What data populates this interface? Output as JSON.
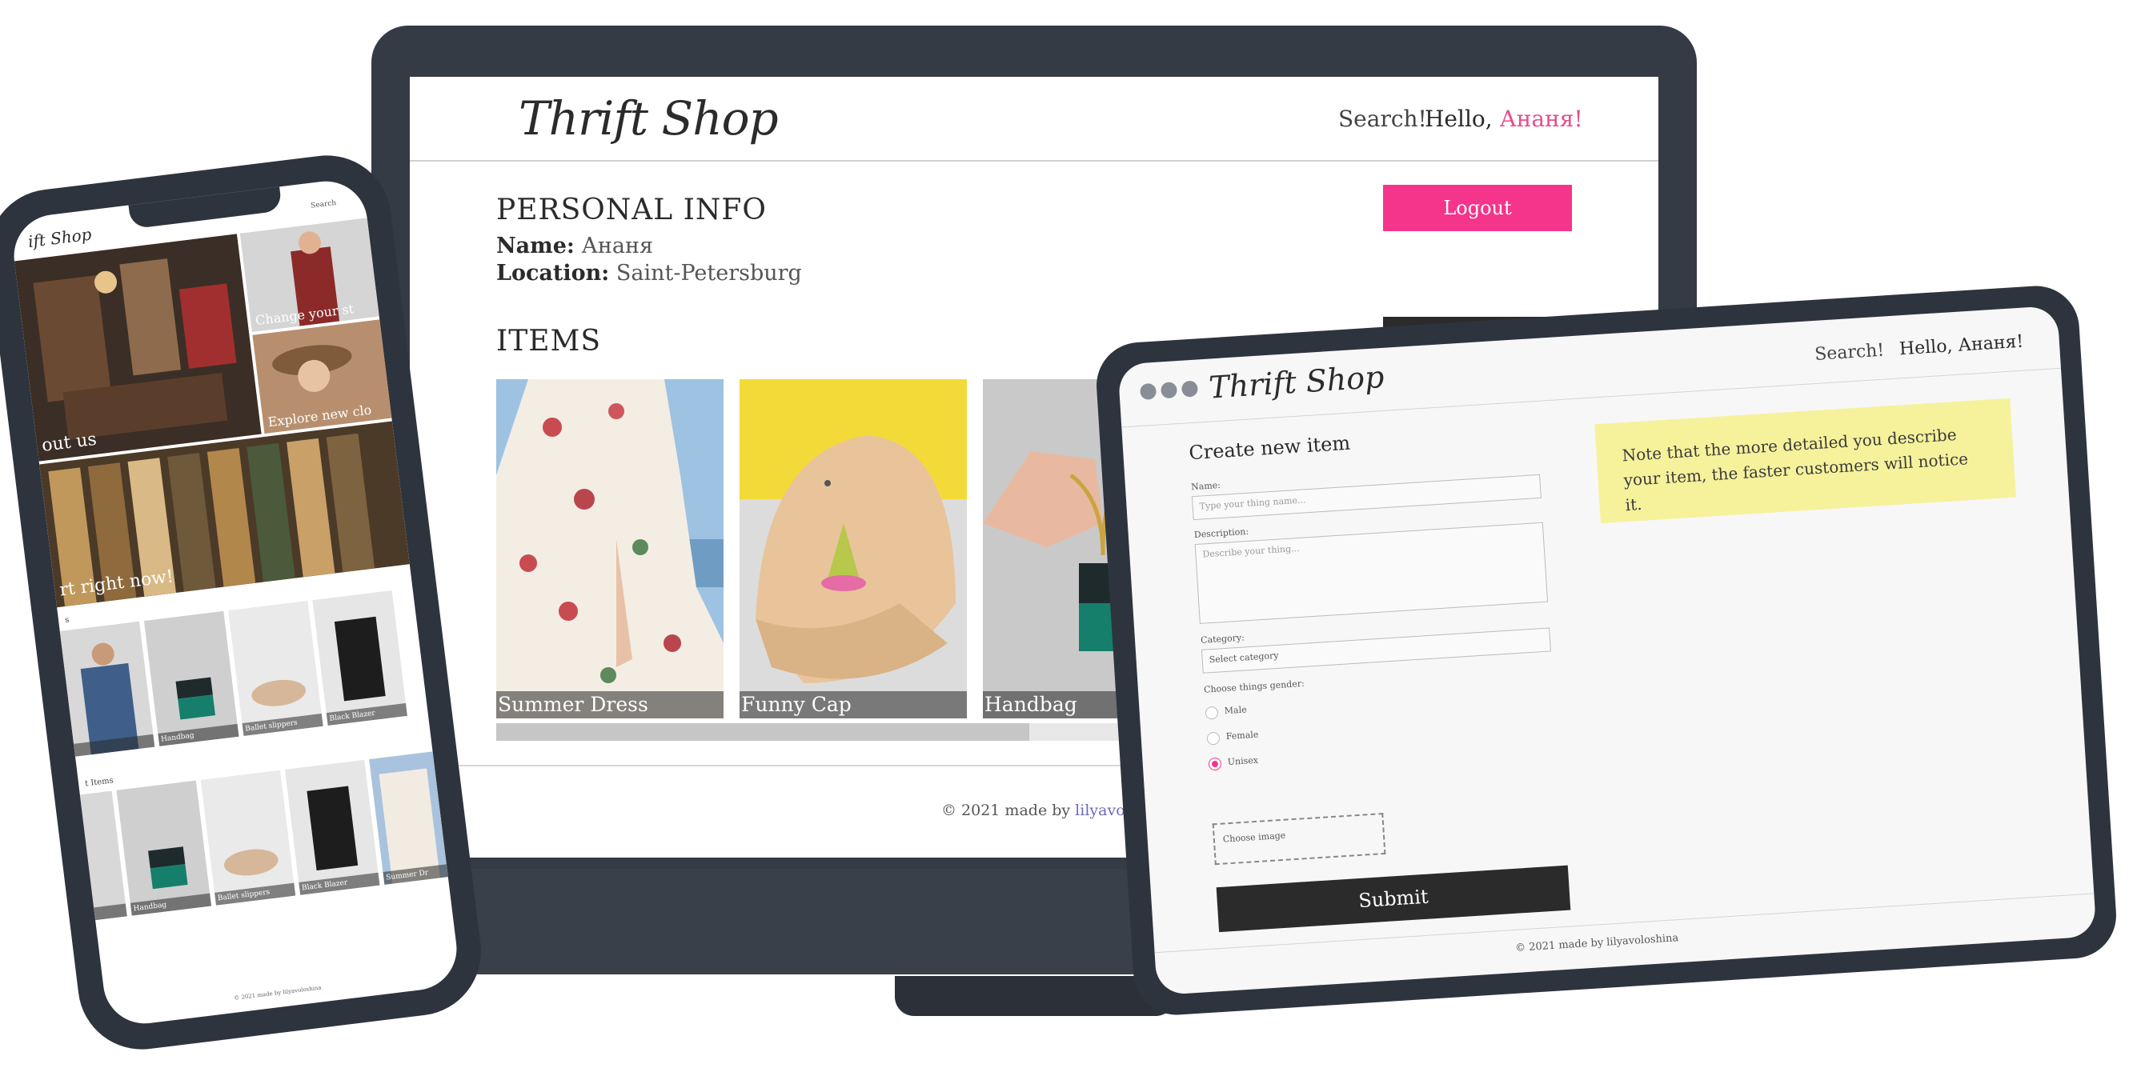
{
  "laptop": {
    "header": {
      "logo": "Thrift Shop",
      "search_label": "Search!",
      "hello_prefix": "Hello, ",
      "hello_name": "Ананя!"
    },
    "personal_info": {
      "title": "PERSONAL INFO",
      "name_label": "Name:",
      "name_value": "Ананя",
      "location_label": "Location:",
      "location_value": "Saint-Petersburg"
    },
    "logout_label": "Logout",
    "items_title": "ITEMS",
    "items": [
      {
        "label": "Summer Dress"
      },
      {
        "label": "Funny Cap"
      },
      {
        "label": "Handbag"
      }
    ],
    "footer": {
      "prefix": "© 2021 made by ",
      "author": "lilyavoloshi"
    }
  },
  "phone": {
    "header": {
      "logo": "ift Shop",
      "search_label": "Search"
    },
    "tiles": {
      "about": "out us",
      "change": "Change your st",
      "explore": "Explore new clo",
      "start": "rt right now!"
    },
    "section_1": "s",
    "section_2": "t Items",
    "row1": [
      "",
      "Handbag",
      "Ballet slippers",
      "Black Blazer"
    ],
    "row2": [
      "",
      "Handbag",
      "Ballet slippers",
      "Black Blazer",
      "Summer Dr"
    ],
    "footer": "© 2021 made by lilyavoloshina"
  },
  "tablet": {
    "header": {
      "logo": "Thrift Shop",
      "search_label": "Search!",
      "hello": "Hello, Ананя!"
    },
    "form": {
      "title": "Create new item",
      "name_label": "Name:",
      "name_placeholder": "Type your thing name...",
      "description_label": "Description:",
      "description_placeholder": "Describe your thing...",
      "category_label": "Category:",
      "category_placeholder": "Select category",
      "gender_label": "Choose things gender:",
      "genders": [
        {
          "label": "Male",
          "selected": false
        },
        {
          "label": "Female",
          "selected": false
        },
        {
          "label": "Unisex",
          "selected": true
        }
      ],
      "choose_image": "Choose image",
      "submit": "Submit"
    },
    "note": "Note that the more detailed you describe your item, the faster customers will notice it.",
    "footer": "© 2021 made by lilyavoloshina"
  },
  "colors": {
    "accent_pink": "#f5348b",
    "device_frame": "#353b45",
    "note_yellow": "#f6f29c",
    "dark_button": "#2b2b2b"
  }
}
